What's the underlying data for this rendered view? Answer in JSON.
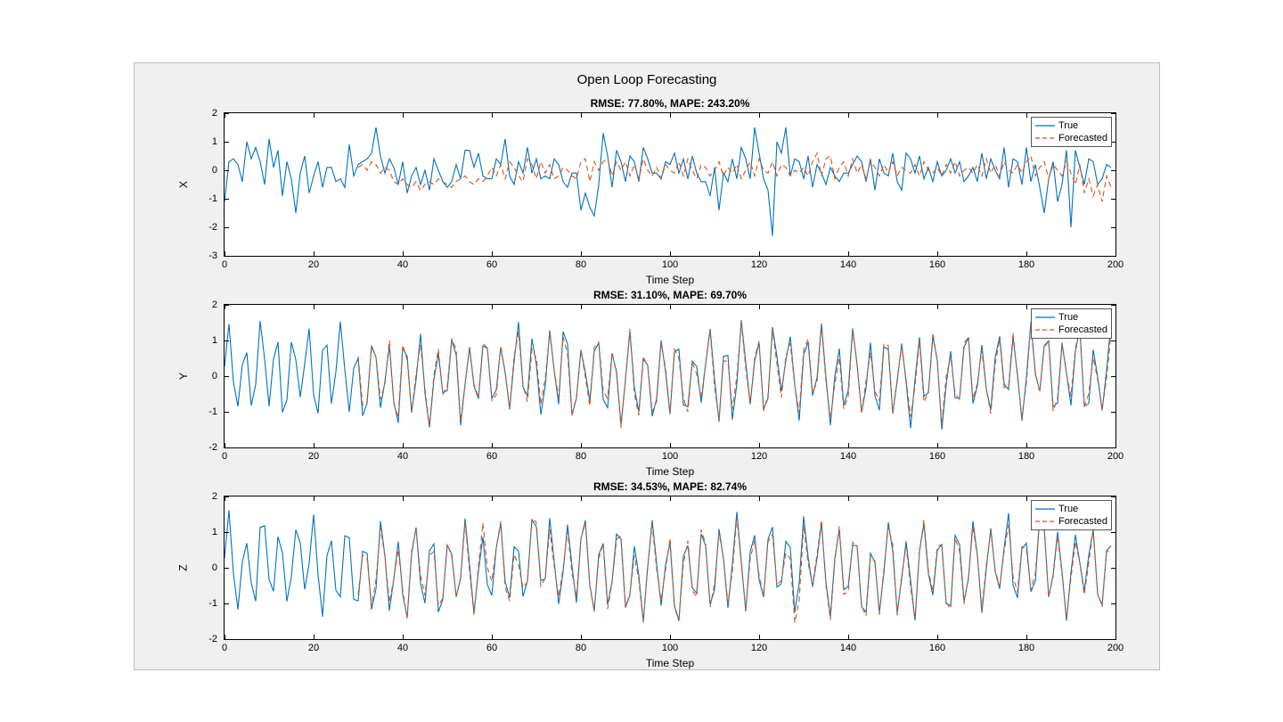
{
  "sgtitle": "Open Loop Forecasting",
  "colors": {
    "true": "#0072BD",
    "forecasted": "#D95319"
  },
  "legend": {
    "true_label": "True",
    "forecasted_label": "Forecasted"
  },
  "xlabel": "Time Step",
  "panels": [
    {
      "id": "X",
      "ylabel": "X",
      "title": "RMSE: 77.80%, MAPE: 243.20%",
      "ylim": [
        -3,
        2
      ],
      "yticks": [
        -3,
        -2,
        -1,
        0,
        1,
        2
      ]
    },
    {
      "id": "Y",
      "ylabel": "Y",
      "title": "RMSE: 31.10%, MAPE: 69.70%",
      "ylim": [
        -2,
        2
      ],
      "yticks": [
        -2,
        -1,
        0,
        1,
        2
      ]
    },
    {
      "id": "Z",
      "ylabel": "Z",
      "title": "RMSE: 34.53%, MAPE: 82.74%",
      "ylim": [
        -2,
        2
      ],
      "yticks": [
        -2,
        -1,
        0,
        1,
        2
      ]
    }
  ],
  "xlim": [
    0,
    200
  ],
  "xticks": [
    0,
    20,
    40,
    60,
    80,
    100,
    120,
    140,
    160,
    180,
    200
  ],
  "chart_data": [
    {
      "type": "line",
      "title": "RMSE: 77.80%, MAPE: 243.20%",
      "xlabel": "Time Step",
      "ylabel": "X",
      "xlim": [
        0,
        200
      ],
      "ylim": [
        -3,
        2
      ],
      "legend_position": "top-right",
      "series": [
        {
          "name": "True",
          "style": "solid",
          "color": "#0072BD",
          "x": [
            0,
            1,
            2,
            3,
            4,
            5,
            6,
            7,
            8,
            9,
            10,
            11,
            12,
            13,
            14,
            15,
            16,
            17,
            18,
            19,
            20,
            21,
            22,
            23,
            24,
            25,
            26,
            27,
            28,
            29,
            30,
            31,
            32,
            33,
            34,
            35,
            36,
            37,
            38,
            39,
            40,
            41,
            42,
            43,
            44,
            45,
            46,
            47,
            48,
            49,
            50,
            51,
            52,
            53,
            54,
            55,
            56,
            57,
            58,
            59,
            60,
            61,
            62,
            63,
            64,
            65,
            66,
            67,
            68,
            69,
            70,
            71,
            72,
            73,
            74,
            75,
            76,
            77,
            78,
            79,
            80,
            81,
            82,
            83,
            84,
            85,
            86,
            87,
            88,
            89,
            90,
            91,
            92,
            93,
            94,
            95,
            96,
            97,
            98,
            99,
            100,
            101,
            102,
            103,
            104,
            105,
            106,
            107,
            108,
            109,
            110,
            111,
            112,
            113,
            114,
            115,
            116,
            117,
            118,
            119,
            120,
            121,
            122,
            123,
            124,
            125,
            126,
            127,
            128,
            129,
            130,
            131,
            132,
            133,
            134,
            135,
            136,
            137,
            138,
            139,
            140,
            141,
            142,
            143,
            144,
            145,
            146,
            147,
            148,
            149,
            150,
            151,
            152,
            153,
            154,
            155,
            156,
            157,
            158,
            159,
            160,
            161,
            162,
            163,
            164,
            165,
            166,
            167,
            168,
            169,
            170,
            171,
            172,
            173,
            174,
            175,
            176,
            177,
            178,
            179,
            180,
            181,
            182,
            183,
            184,
            185,
            186,
            187,
            188,
            189,
            190,
            191,
            192,
            193,
            194,
            195,
            196,
            197,
            198,
            199
          ],
          "values": [
            -1.1,
            0.3,
            0.4,
            0.2,
            -0.4,
            1.0,
            0.4,
            0.8,
            0.3,
            -0.5,
            1.1,
            0.1,
            0.7,
            -0.9,
            0.3,
            -0.3,
            -1.5,
            -0.1,
            0.5,
            -0.8,
            -0.2,
            0.3,
            -0.6,
            0.1,
            0.1,
            -0.4,
            -0.3,
            -0.6,
            0.9,
            -0.2,
            0.2,
            0.3,
            0.4,
            0.6,
            1.5,
            0.5,
            -0.1,
            0.4,
            0.1,
            -0.5,
            0.3,
            -0.8,
            -0.2,
            0.1,
            -0.5,
            0.0,
            -0.7,
            0.4,
            0.0,
            -0.4,
            -0.6,
            -0.4,
            0.2,
            -0.3,
            0.7,
            0.7,
            0.1,
            0.6,
            -0.2,
            -0.3,
            -0.3,
            0.4,
            0.2,
            1.1,
            -0.2,
            -0.5,
            0.3,
            -0.1,
            0.8,
            -0.1,
            0.4,
            -0.3,
            -0.2,
            -0.3,
            0.4,
            0.2,
            -0.4,
            -0.6,
            -0.1,
            -0.1,
            -1.4,
            -0.8,
            -1.3,
            -1.6,
            -0.5,
            1.3,
            0.5,
            -0.6,
            0.7,
            0.3,
            -0.4,
            0.5,
            0.3,
            -0.4,
            0.8,
            0.4,
            -0.1,
            -0.1,
            -0.3,
            0.3,
            0.2,
            0.6,
            -0.1,
            0.4,
            -0.3,
            0.5,
            -0.1,
            -0.4,
            -0.4,
            -0.9,
            0.1,
            -1.4,
            -0.1,
            -0.4,
            0.4,
            -0.3,
            0.8,
            0.4,
            -0.3,
            1.5,
            0.6,
            -0.3,
            -0.7,
            -2.3,
            1.0,
            0.6,
            1.5,
            -0.2,
            0.4,
            0.3,
            -0.3,
            0.5,
            -0.6,
            0.2,
            -0.1,
            -0.5,
            0.1,
            -0.2,
            -0.4,
            -0.1,
            -0.1,
            0.2,
            0.5,
            0.3,
            -0.4,
            0.4,
            -0.7,
            0.4,
            -0.1,
            -0.2,
            0.6,
            -0.4,
            -0.7,
            0.6,
            0.4,
            -0.1,
            0.5,
            -0.3,
            0.1,
            -0.4,
            0.3,
            -0.2,
            0.0,
            0.4,
            -0.1,
            0.3,
            -0.4,
            -0.2,
            0.1,
            -0.4,
            0.6,
            -0.3,
            0.4,
            0.0,
            -0.3,
            0.8,
            -0.6,
            0.4,
            0.3,
            -0.5,
            0.8,
            -0.4,
            0.2,
            -0.6,
            -1.5,
            -0.3,
            0.3,
            -1.1,
            -0.5,
            0.7,
            -2.0,
            0.7,
            0.1,
            -0.5,
            0.4,
            0.3,
            -0.5,
            -0.3,
            0.2,
            0.1
          ]
        },
        {
          "name": "Forecasted",
          "style": "dashed",
          "color": "#D95319",
          "x": [
            30,
            31,
            32,
            33,
            34,
            35,
            36,
            37,
            38,
            39,
            40,
            41,
            42,
            43,
            44,
            45,
            46,
            47,
            48,
            49,
            50,
            51,
            52,
            53,
            54,
            55,
            56,
            57,
            58,
            59,
            60,
            61,
            62,
            63,
            64,
            65,
            66,
            67,
            68,
            69,
            70,
            71,
            72,
            73,
            74,
            75,
            76,
            77,
            78,
            79,
            80,
            81,
            82,
            83,
            84,
            85,
            86,
            87,
            88,
            89,
            90,
            91,
            92,
            93,
            94,
            95,
            96,
            97,
            98,
            99,
            100,
            101,
            102,
            103,
            104,
            105,
            106,
            107,
            108,
            109,
            110,
            111,
            112,
            113,
            114,
            115,
            116,
            117,
            118,
            119,
            120,
            121,
            122,
            123,
            124,
            125,
            126,
            127,
            128,
            129,
            130,
            131,
            132,
            133,
            134,
            135,
            136,
            137,
            138,
            139,
            140,
            141,
            142,
            143,
            144,
            145,
            146,
            147,
            148,
            149,
            150,
            151,
            152,
            153,
            154,
            155,
            156,
            157,
            158,
            159,
            160,
            161,
            162,
            163,
            164,
            165,
            166,
            167,
            168,
            169,
            170,
            171,
            172,
            173,
            174,
            175,
            176,
            177,
            178,
            179,
            180,
            181,
            182,
            183,
            184,
            185,
            186,
            187,
            188,
            189,
            190,
            191,
            192,
            193,
            194,
            195,
            196,
            197,
            198,
            199
          ],
          "values": [
            0.1,
            0.2,
            0.0,
            0.3,
            0.2,
            -0.1,
            0.1,
            0.0,
            -0.4,
            -0.5,
            -0.3,
            -0.5,
            -0.6,
            -0.4,
            -0.7,
            -0.5,
            -0.4,
            -0.5,
            -0.3,
            -0.4,
            -0.5,
            -0.6,
            -0.4,
            -0.3,
            -0.2,
            -0.4,
            -0.5,
            -0.3,
            -0.4,
            -0.2,
            0.1,
            -0.2,
            0.2,
            -0.3,
            0.3,
            0.1,
            -0.2,
            -0.4,
            0.4,
            0.2,
            -0.3,
            0.3,
            -0.1,
            0.2,
            -0.3,
            -0.2,
            0.1,
            0.0,
            -0.2,
            -0.3,
            0.3,
            0.4,
            -0.4,
            0.3,
            0.0,
            0.3,
            0.4,
            -0.2,
            0.3,
            0.0,
            0.3,
            -0.2,
            0.2,
            -0.3,
            0.4,
            0.0,
            -0.2,
            0.1,
            -0.3,
            0.2,
            0.0,
            -0.1,
            0.3,
            -0.2,
            0.4,
            0.0,
            -0.3,
            0.2,
            0.1,
            -0.2,
            0.0,
            0.3,
            -0.2,
            0.1,
            -0.1,
            0.2,
            -0.3,
            0.0,
            0.3,
            -0.2,
            0.4,
            0.0,
            -0.1,
            0.3,
            -0.2,
            0.2,
            0.1,
            -0.2,
            0.0,
            -0.1,
            0.1,
            -0.2,
            0.3,
            0.6,
            -0.2,
            0.4,
            0.5,
            -0.3,
            0.1,
            0.3,
            -0.2,
            0.4,
            -0.1,
            0.2,
            -0.3,
            0.3,
            0.1,
            -0.2,
            0.2,
            -0.1,
            0.3,
            -0.2,
            0.1,
            0.0,
            -0.1,
            0.2,
            -0.2,
            0.3,
            0.0,
            -0.1,
            0.1,
            -0.2,
            0.2,
            -0.1,
            0.3,
            -0.2,
            0.0,
            0.1,
            -0.1,
            0.2,
            -0.2,
            0.4,
            -0.1,
            0.2,
            -0.2,
            0.3,
            0.0,
            -0.1,
            0.2,
            -0.1,
            0.3,
            0.5,
            -0.2,
            0.1,
            0.3,
            -0.3,
            0.2,
            0.0,
            -0.2,
            0.3,
            -0.1,
            -0.5,
            0.2,
            -0.8,
            -0.3,
            -0.9,
            -0.5,
            -1.1,
            -0.2,
            -0.6
          ]
        }
      ]
    },
    {
      "type": "line",
      "title": "RMSE: 31.10%, MAPE: 69.70%",
      "xlabel": "Time Step",
      "ylabel": "Y",
      "xlim": [
        0,
        200
      ],
      "ylim": [
        -2,
        2
      ],
      "legend_position": "top-right",
      "series": [
        {
          "name": "True",
          "style": "solid",
          "color": "#0072BD",
          "x_note": "dense oscillation between about -1.5 and 1.6 at roughly 3-4 step period across 0..199"
        },
        {
          "name": "Forecasted",
          "style": "dashed",
          "color": "#D95319",
          "x_note": "starts near step 30, closely tracks True oscillation with minor lag"
        }
      ]
    },
    {
      "type": "line",
      "title": "RMSE: 34.53%, MAPE: 82.74%",
      "xlabel": "Time Step",
      "ylabel": "Z",
      "xlim": [
        0,
        200
      ],
      "ylim": [
        -2,
        2
      ],
      "legend_position": "top-right",
      "series": [
        {
          "name": "True",
          "style": "solid",
          "color": "#0072BD",
          "x_note": "dense oscillation roughly -1.3..1.4 across 0..199, similar period to Y"
        },
        {
          "name": "Forecasted",
          "style": "dashed",
          "color": "#D95319",
          "x_note": "starts near step 30, tracks True; occasional overshoot to ~1.6 around steps 58-64 and 128-132"
        }
      ]
    }
  ]
}
